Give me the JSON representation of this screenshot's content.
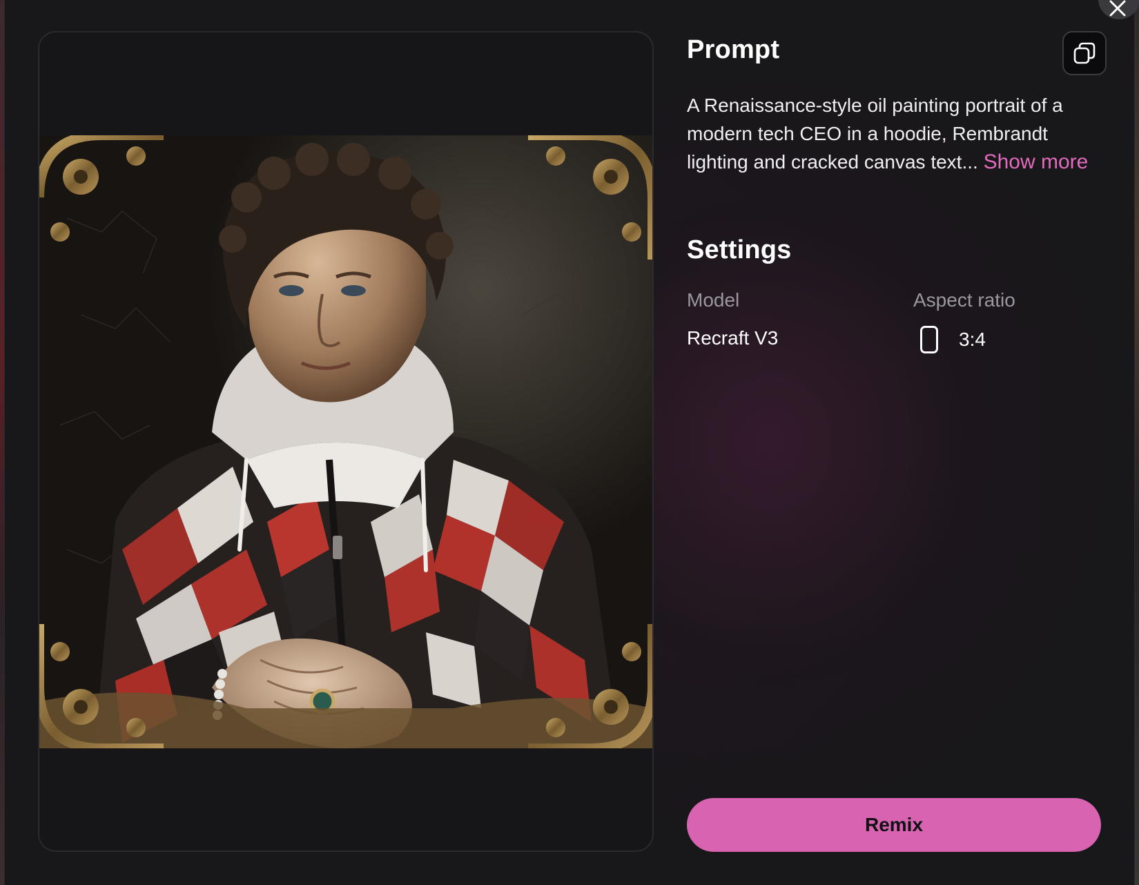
{
  "prompt": {
    "title": "Prompt",
    "text": "A Renaissance-style oil painting portrait of a modern tech CEO in a hoodie, Rembrandt lighting and cracked canvas text...",
    "show_more": "Show more",
    "copy_icon": "copy-icon"
  },
  "settings": {
    "title": "Settings",
    "model_label": "Model",
    "model_value": "Recraft V3",
    "aspect_label": "Aspect ratio",
    "aspect_value": "3:4",
    "aspect_icon": "portrait-ratio-icon"
  },
  "actions": {
    "remix_label": "Remix",
    "close_icon": "close-icon"
  },
  "image": {
    "alt": "Renaissance-style oil painting portrait of a man in a red, white and black hoodie inside an ornate gold frame"
  },
  "colors": {
    "accent": "#d763b1",
    "link": "#e36bbd",
    "background": "#18171a"
  }
}
